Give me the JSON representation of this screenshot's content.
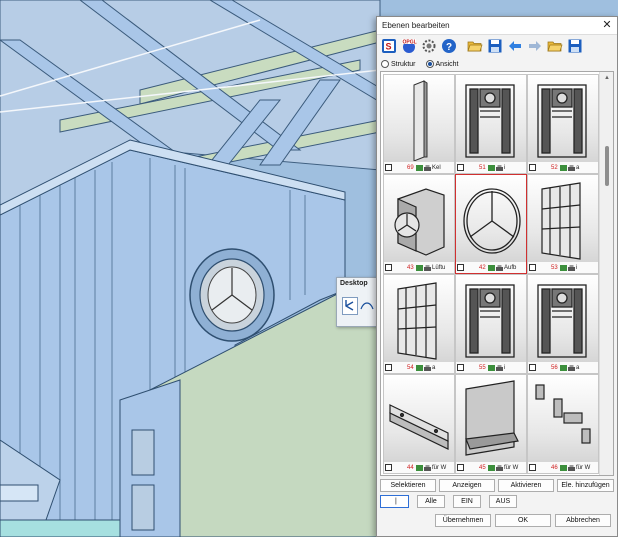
{
  "dialog": {
    "title": "Ebenen bearbeiten",
    "close_glyph": "✕",
    "toolbar": [
      "layers-icon",
      "opengl-icon",
      "settings-icon",
      "help-icon",
      "folder-open-icon",
      "save-icon",
      "arrow-left-icon",
      "arrow-right-icon",
      "folder-open-icon",
      "save-icon"
    ],
    "view_options": [
      {
        "label": "Struktur",
        "selected": false
      },
      {
        "label": "Ansicht",
        "selected": true
      }
    ],
    "layers": [
      {
        "number": "69",
        "label": "Kel",
        "icon": "column-icon"
      },
      {
        "number": "51",
        "label": "i",
        "icon": "wall-frame-icon"
      },
      {
        "number": "52",
        "label": "a",
        "icon": "wall-frame-icon"
      },
      {
        "number": "43",
        "label": "Lüftu",
        "icon": "vent-duct-icon"
      },
      {
        "number": "42",
        "label": "Aufb",
        "icon": "round-window-icon",
        "selected": true
      },
      {
        "number": "53",
        "label": "i",
        "icon": "panel-grid-icon"
      },
      {
        "number": "54",
        "label": "a",
        "icon": "panel-grid-icon"
      },
      {
        "number": "55",
        "label": "i",
        "icon": "wall-frame-icon"
      },
      {
        "number": "56",
        "label": "a",
        "icon": "wall-frame-icon"
      },
      {
        "number": "44",
        "label": "für W",
        "icon": "rail-icon"
      },
      {
        "number": "45",
        "label": "für W",
        "icon": "panel-icon"
      },
      {
        "number": "46",
        "label": "für W",
        "icon": "brackets-icon"
      }
    ],
    "buttons": {
      "select": "Selektieren",
      "show": "Anzeigen",
      "activate": "Aktivieren",
      "add_element": "Ele. hinzufügen",
      "cursor_field": "|",
      "all": "Alle",
      "on": "EIN",
      "off": "AUS",
      "apply": "Übernehmen",
      "ok": "OK",
      "cancel": "Abbrechen"
    }
  },
  "mini_toolbar": {
    "title": "Desktop"
  },
  "colors": {
    "model_fill": "#a9c6e8",
    "wall_fill": "#c5d9c0",
    "accent": "#d03030",
    "selection": "#2f6fd6"
  }
}
